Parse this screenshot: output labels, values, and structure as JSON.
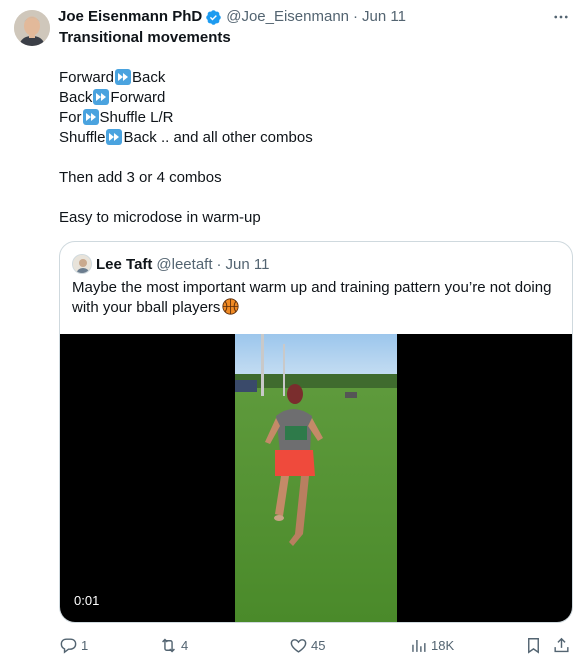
{
  "tweet": {
    "author_name": "Joe Eisenmann PhD",
    "handle": "@Joe_Eisenmann",
    "separator": "·",
    "date": "Jun 11",
    "more_label": "···",
    "lines": {
      "title": "Transitional movements",
      "l1a": "Forward",
      "l1b": "Back",
      "l2a": "Back",
      "l2b": "Forward",
      "l3a": "For",
      "l3b": "Shuffle L/R",
      "l4a": "Shuffle",
      "l4b": "Back .. and all other combos",
      "l5": "Then add 3 or 4 combos",
      "l6": "Easy to microdose in warm-up"
    }
  },
  "quoted": {
    "author_name": "Lee Taft",
    "handle": "@leetaft",
    "separator": "·",
    "date": "Jun 11",
    "text": "Maybe the most important warm up and training pattern you’re not doing with your bball players",
    "video_timestamp": "0:01"
  },
  "actions": {
    "replies": "1",
    "reposts": "4",
    "likes": "45",
    "views": "18K"
  },
  "colors": {
    "verified_blue": "#1d9bf0",
    "muted_text": "#536471",
    "border": "#cfd9de"
  },
  "icons": [
    "verified-badge-icon",
    "more-icon",
    "fast-forward-icon",
    "basketball-icon",
    "reply-icon",
    "repost-icon",
    "like-icon",
    "views-icon",
    "bookmark-icon",
    "share-icon"
  ]
}
